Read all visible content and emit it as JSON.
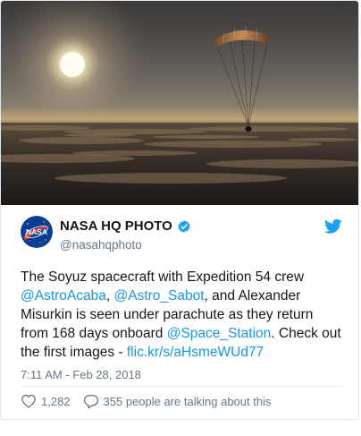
{
  "header": {
    "display_name": "NASA HQ PHOTO",
    "handle": "@nasahqphoto",
    "avatar_text": "NASA"
  },
  "tweet": {
    "text_1": "The Soyuz spacecraft with Expedition 54 crew ",
    "mention_1": "@AstroAcaba",
    "text_2": ", ",
    "mention_2": "@Astro_Sabot",
    "text_3": ", and Alexander Misurkin is seen under parachute as they return from 168 days onboard ",
    "mention_3": "@Space_Station",
    "text_4": ". Check out the first images - ",
    "link": "flic.kr/s/aHsmeWUd77"
  },
  "timestamp": "7:11 AM - Feb 28, 2018",
  "actions": {
    "likes": "1,282",
    "talking": "355 people are talking about this"
  },
  "colors": {
    "link": "#1b95e0",
    "text": "#14171a",
    "secondary": "#657786",
    "verified": "#1da1f2",
    "twitter_bird": "#1da1f2"
  },
  "icons": [
    "verified-badge-icon",
    "twitter-bird-icon",
    "heart-icon",
    "reply-bubble-icon"
  ]
}
